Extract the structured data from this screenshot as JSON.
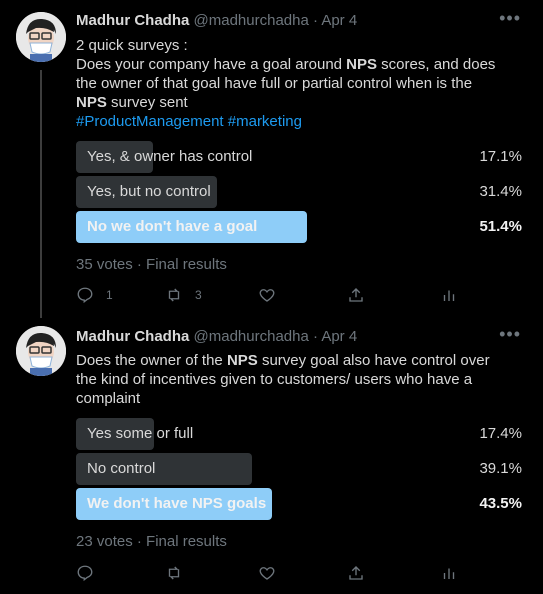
{
  "tweets": [
    {
      "name": "Madhur Chadha",
      "handle": "@madhurchadha",
      "date": "· Apr 4",
      "more": "•••",
      "text_lines": [
        "2 quick surveys :",
        "Does your company have a goal around ",
        "NPS",
        " scores, and does",
        "the owner of that goal have full or partial control when is the",
        "NPS",
        " survey sent"
      ],
      "hashtags": "#ProductManagement #marketing",
      "poll": [
        {
          "label": "Yes, & owner has  control",
          "pct": "17.1%",
          "fraction": 0.171,
          "winner": false
        },
        {
          "label": "Yes, but no control",
          "pct": "31.4%",
          "fraction": 0.314,
          "winner": false
        },
        {
          "label": "No we don't have a goal",
          "pct": "51.4%",
          "fraction": 0.514,
          "winner": true
        }
      ],
      "votes": "35 votes · Final results",
      "reply_count": "1",
      "retweet_count": "3"
    },
    {
      "name": "Madhur Chadha",
      "handle": "@madhurchadha",
      "date": "· Apr 4",
      "more": "•••",
      "text_lines": [
        "Does the owner of the ",
        "NPS",
        " survey goal also have control over",
        "the kind of incentives given to customers/ users who have a",
        "complaint"
      ],
      "poll": [
        {
          "label": "Yes some or full",
          "pct": "17.4%",
          "fraction": 0.174,
          "winner": false
        },
        {
          "label": "No control",
          "pct": "39.1%",
          "fraction": 0.391,
          "winner": false
        },
        {
          "label": "We don't have NPS goals",
          "pct": "43.5%",
          "fraction": 0.435,
          "winner": true
        }
      ],
      "votes": "23 votes · Final results"
    }
  ],
  "colors": {
    "accent": "#1d9bf0",
    "winner_bar": "#8ecdf8",
    "bar": "#2f3336",
    "muted": "#6e767d"
  }
}
